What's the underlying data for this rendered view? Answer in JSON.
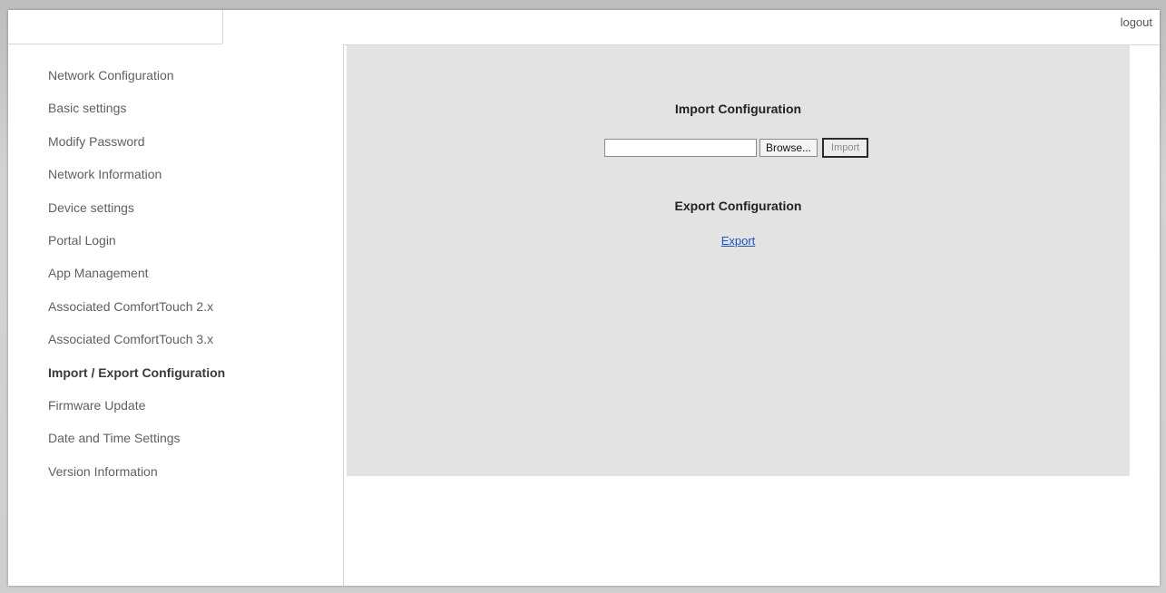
{
  "header": {
    "logout_label": "logout"
  },
  "sidebar": {
    "items": [
      {
        "label": "Network Configuration"
      },
      {
        "label": "Basic settings"
      },
      {
        "label": "Modify Password"
      },
      {
        "label": "Network Information"
      },
      {
        "label": "Device settings"
      },
      {
        "label": "Portal Login"
      },
      {
        "label": "App Management"
      },
      {
        "label": "Associated ComfortTouch 2.x"
      },
      {
        "label": "Associated ComfortTouch 3.x"
      },
      {
        "label": "Import / Export Configuration"
      },
      {
        "label": "Firmware Update"
      },
      {
        "label": "Date and Time Settings"
      },
      {
        "label": "Version Information"
      }
    ],
    "active": "Import / Export Configuration"
  },
  "main": {
    "import_title": "Import Configuration",
    "file_input_value": "",
    "browse_label": "Browse...",
    "import_label": "Import",
    "export_title": "Export Configuration",
    "export_link_label": "Export"
  },
  "colors": {
    "content_bg": "#e3e3e3",
    "link": "#2050c0",
    "sidebar_text": "#606060"
  }
}
